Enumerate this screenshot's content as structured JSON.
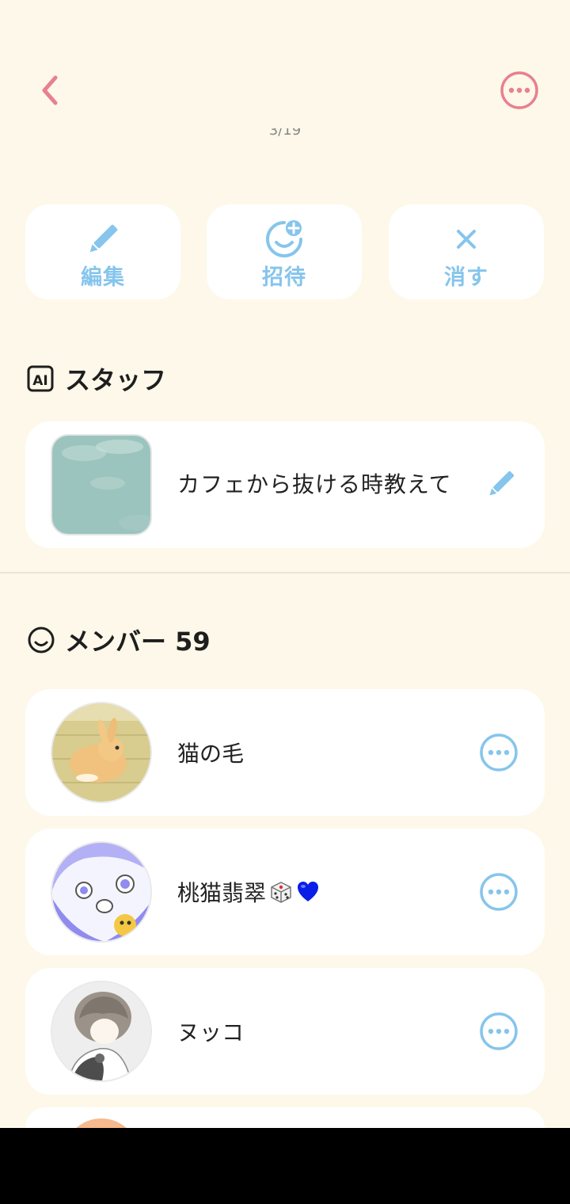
{
  "header": {
    "back_icon": "chevron-left-icon",
    "more_icon": "more-horizontal-icon",
    "subtitle_fragment": "3/19"
  },
  "actions": {
    "edit_label": "編集",
    "invite_label": "招待",
    "delete_label": "消す",
    "edit_icon": "pencil-icon",
    "invite_icon": "smiley-plus-icon",
    "delete_icon": "close-icon"
  },
  "staff": {
    "title": "スタッフ",
    "icon": "ai-badge-icon",
    "item": {
      "text": "カフェから抜ける時教えて",
      "thumbnail": "sky-photo",
      "edit_icon": "pencil-icon"
    }
  },
  "members": {
    "title": "メンバー 59",
    "icon": "smiley-icon",
    "list": [
      {
        "name": "猫の毛",
        "avatar": "rabbit-photo",
        "more_icon": "more-horizontal-icon"
      },
      {
        "name": "桃猫翡翠",
        "avatar": "anime-avatar",
        "emoji": [
          "dice-emoji",
          "blue-heart-emoji"
        ],
        "more_icon": "more-horizontal-icon"
      },
      {
        "name": "ヌッコ",
        "avatar": "sketch-avatar",
        "more_icon": "more-horizontal-icon"
      }
    ]
  },
  "colors": {
    "background": "#fdf8e9",
    "card": "#ffffff",
    "accent_blue": "#86c5ec",
    "accent_pink": "#e8808f",
    "text": "#222222"
  }
}
